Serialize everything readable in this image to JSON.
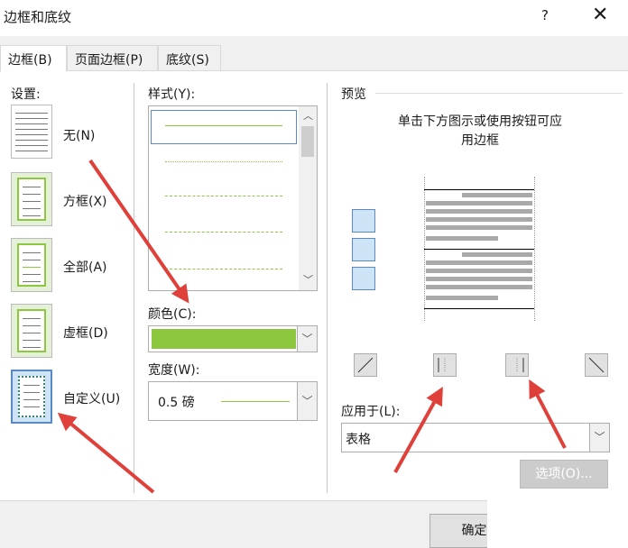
{
  "window": {
    "title": "边框和底纹",
    "help": "?",
    "close": "✕"
  },
  "tabs": [
    {
      "label": "边框(B)"
    },
    {
      "label": "页面边框(P)"
    },
    {
      "label": "底纹(S)"
    }
  ],
  "settings": {
    "label": "设置:",
    "items": [
      {
        "label": "无(N)"
      },
      {
        "label": "方框(X)"
      },
      {
        "label": "全部(A)"
      },
      {
        "label": "虚框(D)"
      },
      {
        "label": "自定义(U)"
      }
    ]
  },
  "style": {
    "label": "样式(Y):"
  },
  "color": {
    "label": "颜色(C):",
    "value": "#8dc63f"
  },
  "width": {
    "label": "宽度(W):",
    "value": "0.5 磅"
  },
  "preview": {
    "label": "预览",
    "hint_line1": "单击下方图示或使用按钮可应",
    "hint_line2": "用边框"
  },
  "apply": {
    "label": "应用于(L):",
    "value": "表格"
  },
  "buttons": {
    "options": "选项(O)...",
    "ok": "确定"
  },
  "colors": {
    "accent": "#8dc63f",
    "arrow": "#e0403a",
    "selected": "#5a8ac6"
  }
}
